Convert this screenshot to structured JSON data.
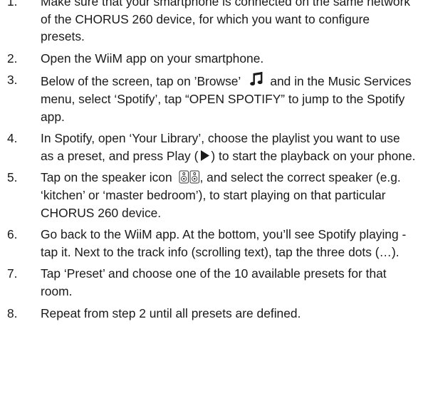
{
  "steps": [
    {
      "number": "1.",
      "text": "Make sure that your smartphone is connected on the same network of the CHORUS 260 device, for which you want to configure presets."
    },
    {
      "number": "2.",
      "text": "Open the WiiM app on your smartphone."
    },
    {
      "number": "3.",
      "text_before": "Below of the screen, tap on ’Browse’",
      "icon": "music-note-icon",
      "text_after": "and in the Music Services menu, select ‘Spotify’, tap “OPEN SPOTIFY” to jump to the Spotify app."
    },
    {
      "number": "4.",
      "text_before": "In Spotify, open ‘Your Library’, choose the playlist you want to use as a preset, and press Play (",
      "icon": "play-icon",
      "text_after": ") to start the playback on your phone."
    },
    {
      "number": "5.",
      "text_before": "Tap on the speaker icon",
      "icon": "speaker-icon",
      "text_after": ", and select the correct speaker (e.g. ‘kitchen’ or ‘master bedroom’), to start playing on that particular CHORUS 260 device."
    },
    {
      "number": "6.",
      "text": "Go back to the WiiM app. At the bottom, you’ll see Spotify playing - tap it. Next to the track info (scrolling text), tap the three dots (…)."
    },
    {
      "number": "7.",
      "text": "Tap ‘Preset’ and choose one of the 10 available presets for that room."
    },
    {
      "number": "8.",
      "text": "Repeat from step 2 until all presets are defined."
    }
  ]
}
